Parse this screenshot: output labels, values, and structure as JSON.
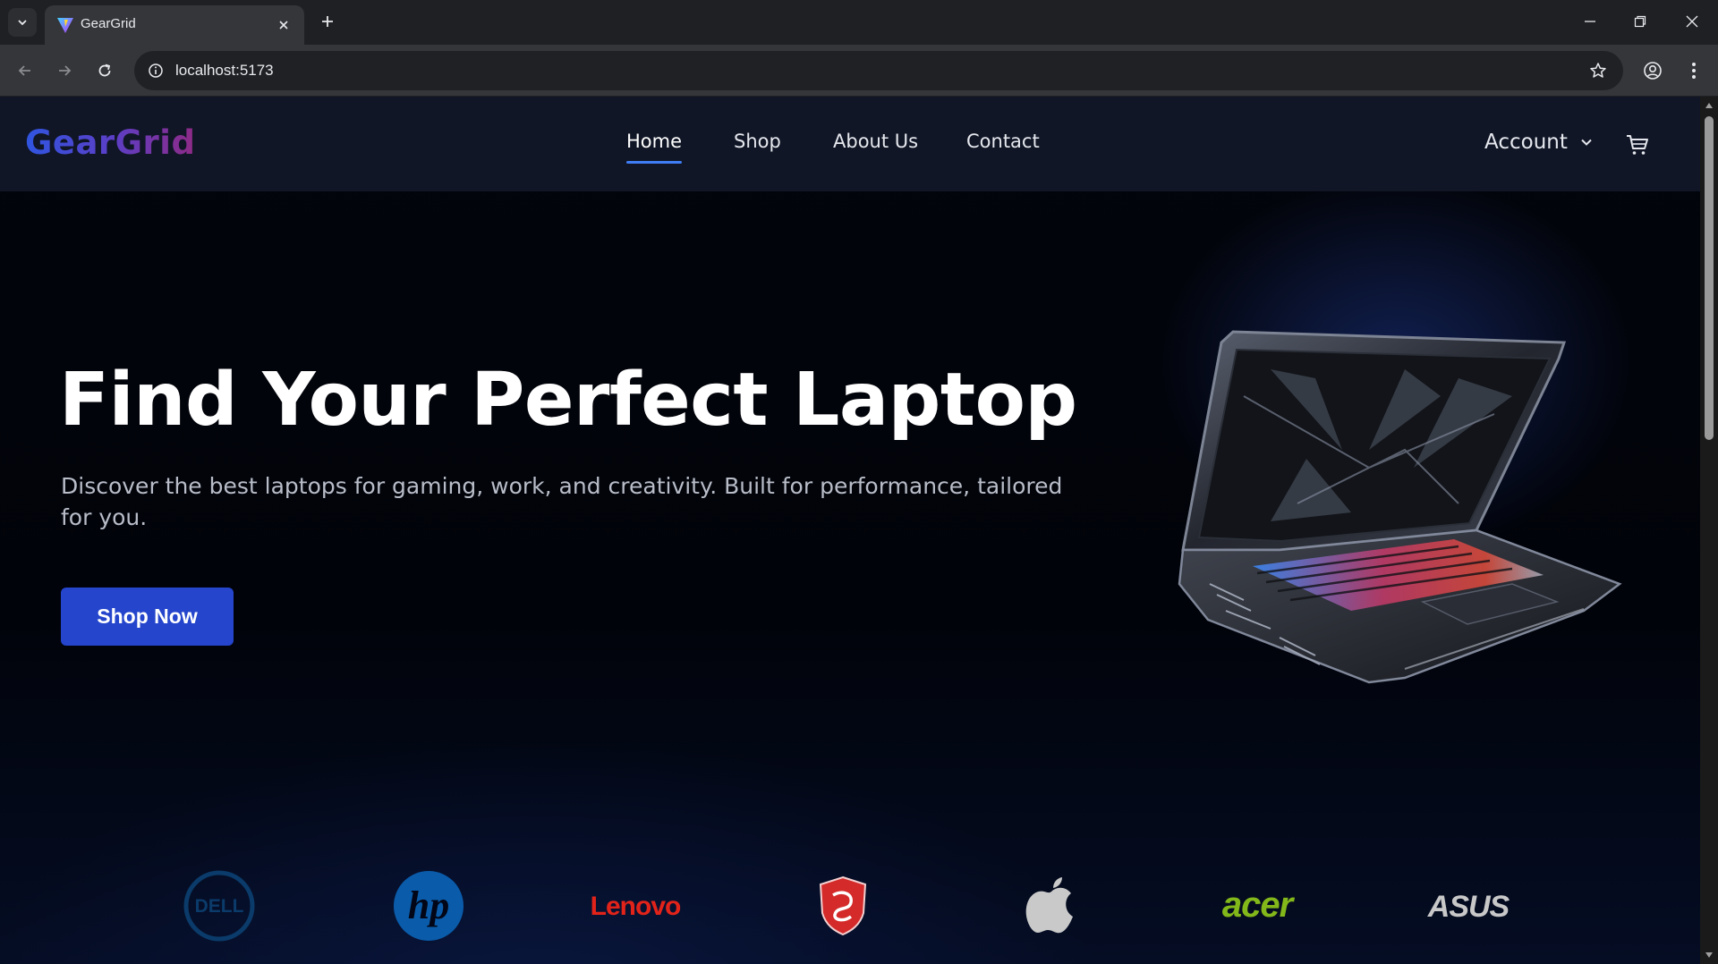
{
  "browser": {
    "tab_title": "GearGrid",
    "url": "localhost:5173",
    "icons": [
      "tab-list-icon",
      "favicon-icon",
      "close-icon",
      "plus-icon",
      "minimize-icon",
      "restore-icon",
      "window-close-icon",
      "back-icon",
      "forward-icon",
      "reload-icon",
      "site-info-icon",
      "star-icon",
      "profile-icon",
      "more-icon"
    ]
  },
  "header": {
    "logo": "GearGrid",
    "nav": [
      {
        "label": "Home",
        "active": true
      },
      {
        "label": "Shop",
        "active": false
      },
      {
        "label": "About Us",
        "active": false
      },
      {
        "label": "Contact",
        "active": false
      }
    ],
    "account_label": "Account",
    "icons": [
      "chevron-down-icon",
      "cart-icon"
    ]
  },
  "hero": {
    "title": "Find Your Perfect Laptop",
    "subtitle": "Discover the best laptops for gaming, work, and creativity. Built for performance, tailored for you.",
    "cta": "Shop Now",
    "image": "gaming-laptop-image"
  },
  "brands": [
    {
      "name": "DELL",
      "color": "#0b3b6a"
    },
    {
      "name": "hp",
      "color": "#0a5cab"
    },
    {
      "name": "Lenovo",
      "color": "#e2231a"
    },
    {
      "name": "msi",
      "color": "#d42a2a"
    },
    {
      "name": "apple",
      "color": "#c9c9c9"
    },
    {
      "name": "acer",
      "color": "#83b81a"
    },
    {
      "name": "ASUS",
      "color": "#c8c8c8"
    }
  ],
  "colors": {
    "header_bg": "#101626",
    "accent": "#2445cc",
    "nav_underline": "#3f7df5",
    "chrome_bg": "#35363a"
  }
}
